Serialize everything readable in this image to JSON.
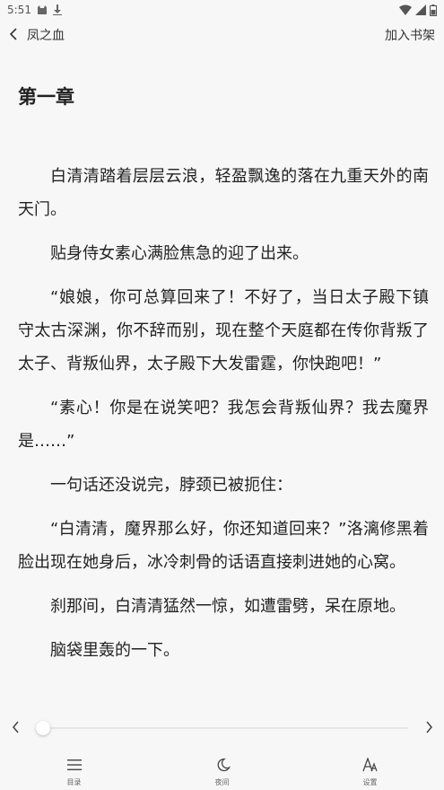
{
  "status_bar": {
    "time": "5:51",
    "icons_left": [
      "cat-notification-icon",
      "download-icon"
    ],
    "icons_right": [
      "wifi-icon",
      "signal-icon",
      "battery-icon"
    ]
  },
  "header": {
    "book_title": "凤之血",
    "add_to_shelf_label": "加入书架"
  },
  "chapter": {
    "title": "第一章",
    "paragraphs": [
      "白清清踏着层层云浪，轻盈飘逸的落在九重天外的南天门。",
      "贴身侍女素心满脸焦急的迎了出来。",
      "“娘娘，你可总算回来了！不好了，当日太子殿下镇守太古深渊，你不辞而别，现在整个天庭都在传你背叛了太子、背叛仙界，太子殿下大发雷霆，你快跑吧！”",
      "“素心！你是在说笑吧？我怎会背叛仙界？我去魔界是……”",
      "一句话还没说完，脖颈已被扼住：",
      "“白清清，魔界那么好，你还知道回来？”洛漓修黑着脸出现在她身后，冰冷刺骨的话语直接刺进她的心窝。",
      "刹那间，白清清猛然一惊，如遭雷劈，呆在原地。",
      "脑袋里轰的一下。"
    ]
  },
  "progress": {
    "fraction": 0.0
  },
  "bottom_nav": {
    "catalog_label": "目录",
    "night_label": "夜间",
    "settings_label": "设置"
  }
}
